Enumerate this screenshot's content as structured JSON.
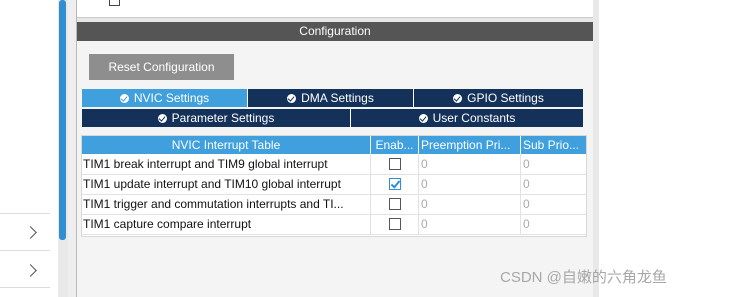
{
  "configuration": {
    "header": "Configuration",
    "reset_button": "Reset Configuration",
    "tabs_row1": [
      {
        "label": "NVIC Settings",
        "active": true
      },
      {
        "label": "DMA Settings",
        "active": false
      },
      {
        "label": "GPIO Settings",
        "active": false
      }
    ],
    "tabs_row2": [
      {
        "label": "Parameter Settings",
        "active": false
      },
      {
        "label": "User Constants",
        "active": false
      }
    ]
  },
  "nvic_table": {
    "columns": [
      "NVIC Interrupt Table",
      "Enab...",
      "Preemption Pri...",
      "Sub Prio..."
    ],
    "rows": [
      {
        "name": "TIM1 break interrupt and TIM9 global interrupt",
        "enabled": false,
        "preemption": "0",
        "sub": "0"
      },
      {
        "name": "TIM1 update interrupt and TIM10 global interrupt",
        "enabled": true,
        "preemption": "0",
        "sub": "0"
      },
      {
        "name": "TIM1 trigger and commutation interrupts and TI...",
        "enabled": false,
        "preemption": "0",
        "sub": "0"
      },
      {
        "name": "TIM1 capture compare interrupt",
        "enabled": false,
        "preemption": "0",
        "sub": "0"
      }
    ]
  },
  "watermark": "CSDN @自嫩的六角龙鱼",
  "colors": {
    "tab_active": "#3fa0dd",
    "tab_inactive": "#14315a",
    "header_bg": "#555555",
    "button_bg": "#8e8e8e",
    "scroll_thumb": "#2f8fd0"
  }
}
